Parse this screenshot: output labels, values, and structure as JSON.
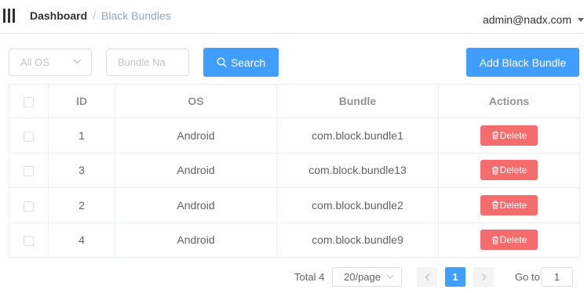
{
  "header": {
    "breadcrumb": {
      "home": "Dashboard",
      "separator": "/",
      "current": "Black Bundles"
    },
    "user": "admin@nadx.com"
  },
  "filters": {
    "os_select": {
      "placeholder": "All OS"
    },
    "bundle_input": {
      "placeholder": "Bundle Na",
      "value": ""
    },
    "search_label": "Search",
    "add_label": "Add Black Bundle"
  },
  "table": {
    "columns": [
      "",
      "ID",
      "OS",
      "Bundle",
      "Actions"
    ],
    "rows": [
      {
        "id": "1",
        "os": "Android",
        "bundle": "com.block.bundle1",
        "action": "Delete"
      },
      {
        "id": "3",
        "os": "Android",
        "bundle": "com.block.bundle13",
        "action": "Delete"
      },
      {
        "id": "2",
        "os": "Android",
        "bundle": "com.block.bundle2",
        "action": "Delete"
      },
      {
        "id": "4",
        "os": "Android",
        "bundle": "com.block.bundle9",
        "action": "Delete"
      }
    ]
  },
  "pagination": {
    "total": "Total 4",
    "page_size": "20/page",
    "current_page": "1",
    "goto_label": "Go to",
    "goto_value": "1"
  },
  "colors": {
    "primary": "#409eff",
    "danger": "#f56c6c"
  }
}
